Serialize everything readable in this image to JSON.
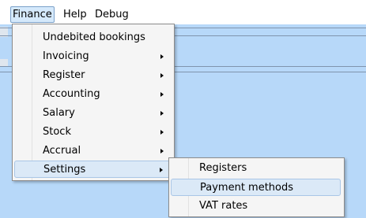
{
  "menubar": {
    "items": [
      {
        "label": "Finance"
      },
      {
        "label": "Help"
      },
      {
        "label": "Debug"
      }
    ]
  },
  "finance_menu": {
    "items": [
      {
        "label": "Undebited bookings"
      },
      {
        "label": "Invoicing"
      },
      {
        "label": "Register"
      },
      {
        "label": "Accounting"
      },
      {
        "label": "Salary"
      },
      {
        "label": "Stock"
      },
      {
        "label": "Accrual"
      },
      {
        "label": "Settings"
      }
    ]
  },
  "settings_submenu": {
    "items": [
      {
        "label": "Registers"
      },
      {
        "label": "Payment methods"
      },
      {
        "label": "VAT rates"
      }
    ]
  },
  "colors": {
    "workspace": "#b7d8f9",
    "menu_background": "#f5f5f5",
    "highlight": "#dbe9f7"
  }
}
